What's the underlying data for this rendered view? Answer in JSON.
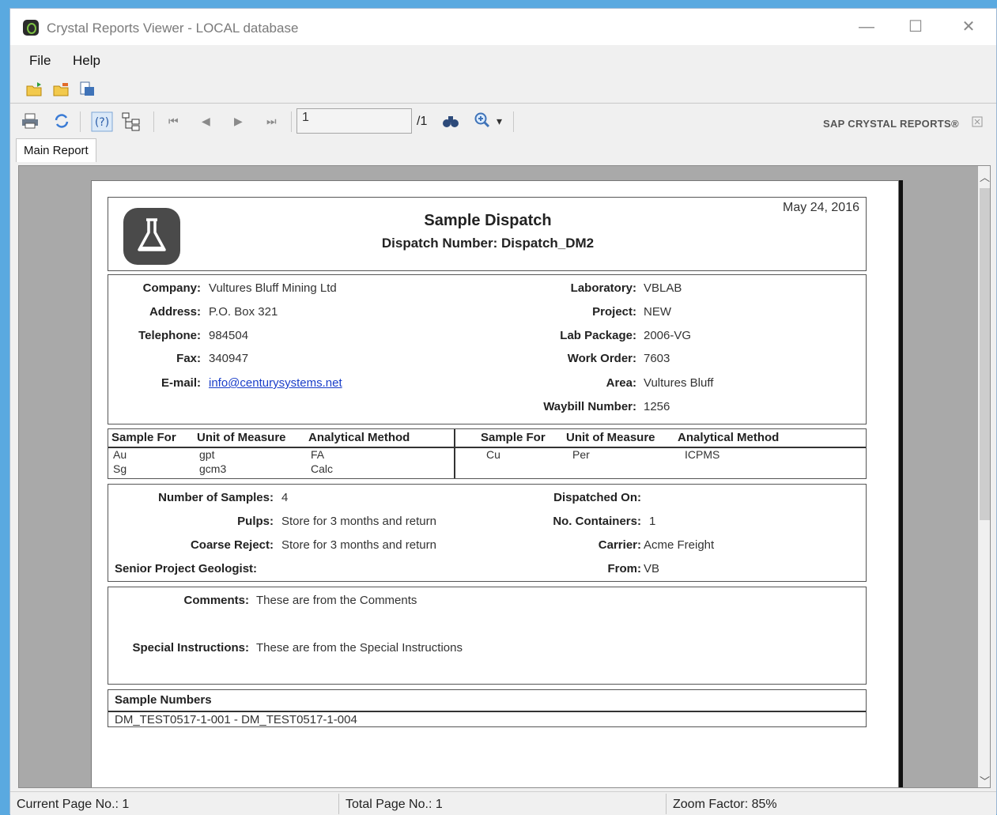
{
  "window": {
    "title": "Crystal Reports Viewer - LOCAL database",
    "minimize": "—",
    "maximize": "☐",
    "close": "✕"
  },
  "menu": [
    "File",
    "Help"
  ],
  "toolbar": {
    "page_value": "1",
    "page_total": "/1",
    "zoom_arrow": "▾",
    "brand": "SAP CRYSTAL REPORTS®"
  },
  "tabs": [
    "Main Report"
  ],
  "report": {
    "title": "Sample Dispatch",
    "dispatch_line": "Dispatch Number: Dispatch_DM2",
    "date": "May 24, 2016",
    "left_fields": [
      {
        "label": "Company:",
        "value": "Vultures Bluff Mining Ltd"
      },
      {
        "label": "Address:",
        "value": "P.O. Box 321"
      },
      {
        "label": "Telephone:",
        "value": "984504"
      },
      {
        "label": "Fax:",
        "value": "340947"
      },
      {
        "label": "E-mail:",
        "value": "info@centurysystems.net"
      }
    ],
    "right_fields": [
      {
        "label": "Laboratory:",
        "value": "VBLAB"
      },
      {
        "label": "Project:",
        "value": "NEW"
      },
      {
        "label": "Lab Package:",
        "value": "2006-VG"
      },
      {
        "label": "Work Order:",
        "value": "7603"
      },
      {
        "label": "Area:",
        "value": "Vultures Bluff"
      },
      {
        "label": "Waybill Number:",
        "value": "1256"
      }
    ],
    "method_headers": [
      "Sample For",
      "Unit of Measure",
      "Analytical Method"
    ],
    "methods_left": [
      [
        "Au",
        "gpt",
        "FA"
      ],
      [
        "Sg",
        "gcm3",
        "Calc"
      ]
    ],
    "methods_right": [
      [
        "Cu",
        "Per",
        "ICPMS"
      ]
    ],
    "samples_left": [
      {
        "label": "Number of Samples:",
        "value": "4"
      },
      {
        "label": "Pulps:",
        "value": "Store for 3 months and return"
      },
      {
        "label": "Coarse Reject:",
        "value": "Store for 3 months and return"
      },
      {
        "label": "Senior Project Geologist:",
        "value": ""
      }
    ],
    "samples_right": [
      {
        "label": "Dispatched On:",
        "value": ""
      },
      {
        "label": "No. Containers:",
        "value": "1"
      },
      {
        "label": "Carrier:",
        "value": "Acme Freight"
      },
      {
        "label": "From:",
        "value": "VB"
      }
    ],
    "comments_label": "Comments:",
    "comments_value": "These are from the Comments",
    "special_label": "Special Instructions:",
    "special_value": "These are from the Special Instructions",
    "sample_numbers_header": "Sample Numbers",
    "sample_numbers_value": "DM_TEST0517-1-001 - DM_TEST0517-1-004"
  },
  "status": {
    "current": "Current Page No.: 1",
    "total": "Total Page No.: 1",
    "zoom": "Zoom Factor: 85%"
  }
}
